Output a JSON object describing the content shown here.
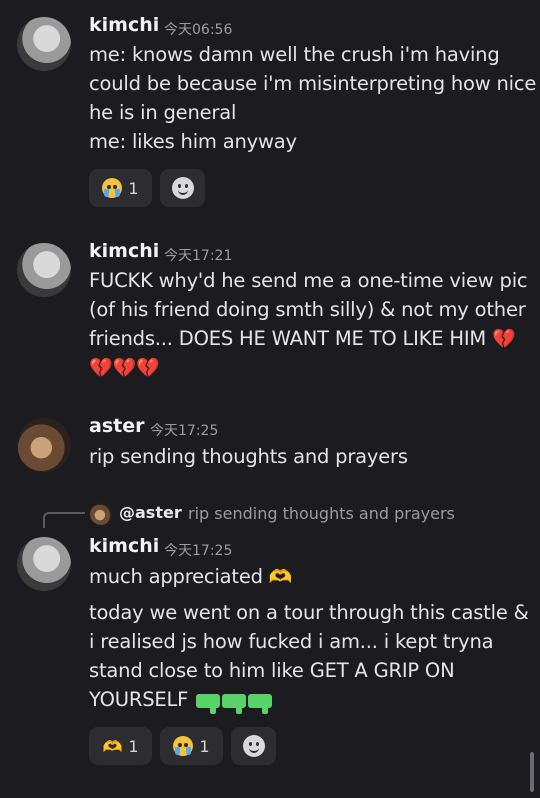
{
  "messages": [
    {
      "author": "kimchi",
      "timestamp": "今天06:56",
      "lines": [
        "me: knows damn well the crush i'm having",
        "could be because i'm misinterpreting how nice",
        "he is in general",
        "me: likes him anyway"
      ],
      "reactions": [
        {
          "emoji": "loudly-crying-face",
          "count": "1"
        }
      ]
    },
    {
      "author": "kimchi",
      "timestamp": "今天17:21",
      "lines": [
        "FUCKK why'd he send me a one-time view pic",
        "(of his friend doing smth silly) & not my other",
        "friends... DOES HE WANT ME TO LIKE HIM",
        ""
      ]
    },
    {
      "author": "aster",
      "timestamp": "今天17:25",
      "lines": [
        "rip sending thoughts and prayers"
      ]
    },
    {
      "reply": {
        "user": "@aster",
        "text": "rip sending thoughts and prayers"
      },
      "author": "kimchi",
      "timestamp": "今天17:25",
      "lines": [
        "much appreciated",
        "today we went on a tour through this castle &",
        "i realised js how fucked i am... i kept tryna",
        "stand close to him like GET A GRIP ON",
        "YOURSELF"
      ],
      "reactions": [
        {
          "emoji": "heart-hands",
          "count": "1"
        },
        {
          "emoji": "loudly-crying-face",
          "count": "1"
        }
      ]
    }
  ],
  "icons": {
    "broken_heart": "broken-heart-icon",
    "water_pistol": "water-pistol-icon",
    "add_reaction": "add-reaction-icon"
  },
  "colors": {
    "background": "#1c1c20",
    "reaction_bg": "#2c2c31",
    "timestamp": "#9b9ba3"
  }
}
